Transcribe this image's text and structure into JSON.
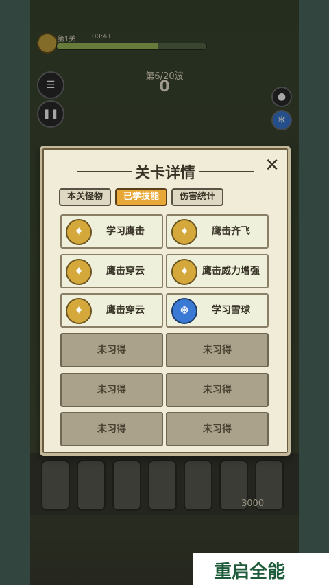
{
  "hud": {
    "level_label": "第1关",
    "timer": "00:41",
    "wave_label": "第6/20波",
    "score": "0",
    "pause_icon": "pause-icon",
    "progress": 0.68
  },
  "dialog": {
    "title": "关卡详情",
    "close_icon": "close-icon",
    "tabs": [
      {
        "label": "本关怪物",
        "active": false
      },
      {
        "label": "已学技能",
        "active": true
      },
      {
        "label": "伤害统计",
        "active": false
      }
    ],
    "skills": [
      {
        "name": "学习鹰击",
        "icon": "eagle-icon"
      },
      {
        "name": "鹰击齐飞",
        "icon": "eagle-icon"
      },
      {
        "name": "鹰击穿云",
        "icon": "eagle-icon"
      },
      {
        "name": "鹰击威力增强",
        "icon": "eagle-icon"
      },
      {
        "name": "鹰击穿云",
        "icon": "eagle-icon"
      },
      {
        "name": "学习雪球",
        "icon": "snowball-icon"
      }
    ],
    "locked_label": "未习得",
    "locked_count": 6
  },
  "battlefield": {
    "wall_hp": "3000"
  },
  "watermark": {
    "text": "重启全能"
  },
  "colors": {
    "tab_active": "#e8a838",
    "panel_bg": "#f1ecd8",
    "locked_bg": "#aaa28a"
  }
}
